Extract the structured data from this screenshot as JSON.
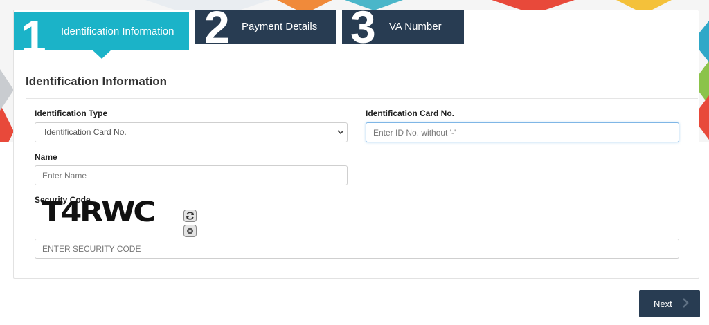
{
  "steps": [
    {
      "number": "1",
      "label": "Identification Information",
      "active": true
    },
    {
      "number": "2",
      "label": "Payment Details",
      "active": false
    },
    {
      "number": "3",
      "label": "VA Number",
      "active": false
    }
  ],
  "section": {
    "title": "Identification Information"
  },
  "form": {
    "id_type": {
      "label": "Identification Type",
      "value": "Identification Card No."
    },
    "id_card": {
      "label": "Identification Card No.",
      "placeholder": "Enter ID No. without '-'"
    },
    "name": {
      "label": "Name",
      "placeholder": "Enter Name"
    },
    "security": {
      "label": "Security Code",
      "captcha_text": "T4RWC",
      "placeholder": "ENTER SECURITY CODE",
      "refresh_icon": "refresh-icon",
      "audio_icon": "audio-icon"
    }
  },
  "actions": {
    "next_label": "Next",
    "next_icon": "chevron-right-icon"
  },
  "colors": {
    "active_step": "#1bb3c8",
    "inactive_step": "#283c52",
    "button": "#283c52"
  }
}
